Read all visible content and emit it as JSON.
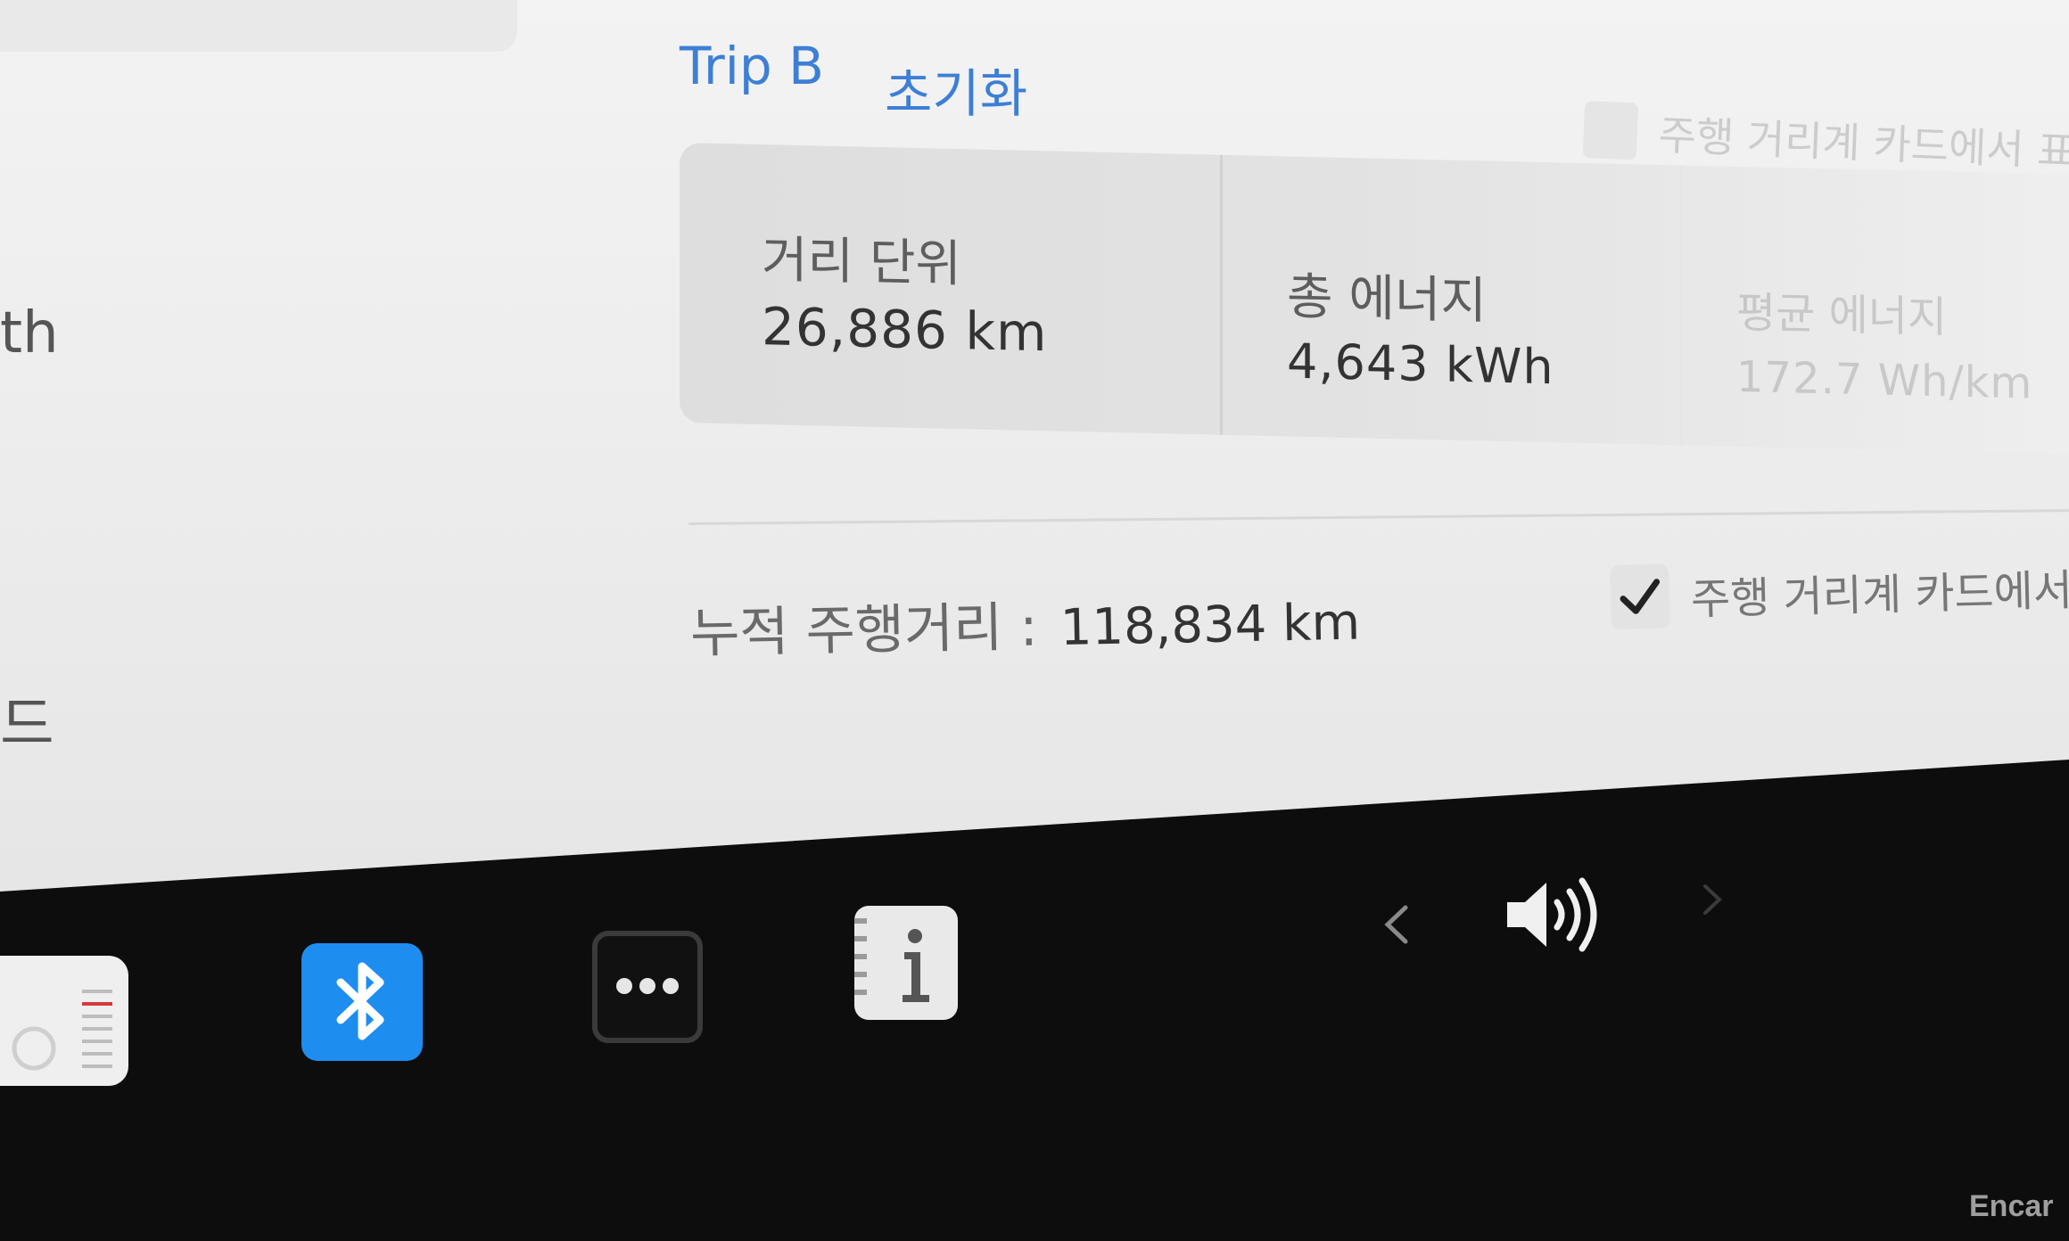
{
  "screen": {
    "left_fragments": {
      "upper": "th",
      "lower": "드"
    },
    "trip": {
      "title": "Trip B",
      "reset_label": "초기화",
      "show_on_card_label": "주행 거리계 카드에서 표시"
    },
    "stats": [
      {
        "label": "거리 단위",
        "value": "26,886 km"
      },
      {
        "label": "총 에너지",
        "value": "4,643 kWh"
      },
      {
        "label": "평균 에너지",
        "value": "172.7 Wh/km"
      }
    ],
    "odometer": {
      "label": "누적 주행거리 :",
      "value": "118,834 km"
    },
    "show_odometer_on_card": {
      "checked": true,
      "label": "주행 거리계 카드에서 표시"
    }
  },
  "taskbar": {
    "icons": [
      "toybox-icon",
      "bluetooth-icon",
      "more-icon",
      "manual-icon",
      "chevron-left-icon",
      "speaker-icon",
      "chevron-right-icon"
    ],
    "accent_color": "#1e8df0"
  },
  "watermark": "Encar",
  "colors": {
    "link_blue": "#3d7fd6",
    "panel_gray": "#e0e0e0",
    "taskbar_black": "#0d0d0d"
  }
}
